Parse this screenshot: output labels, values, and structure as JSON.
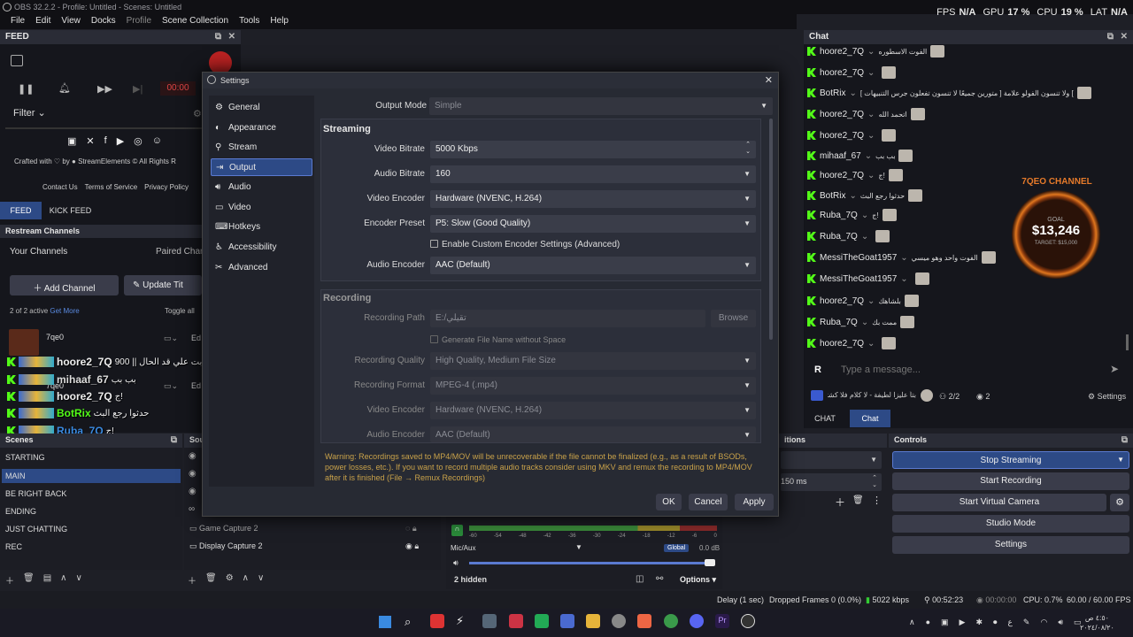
{
  "window": {
    "title": "OBS 32.2.2 - Profile: Untitled - Scenes: Untitled"
  },
  "menu": [
    "File",
    "Edit",
    "View",
    "Docks",
    "Profile",
    "Scene Collection",
    "Tools",
    "Help"
  ],
  "stats": {
    "fps_label": "FPS",
    "fps": "N/A",
    "gpu_label": "GPU",
    "gpu": "17 %",
    "cpu_label": "CPU",
    "cpu": "19 %",
    "lat_label": "LAT",
    "lat": "N/A"
  },
  "feed": {
    "title": "FEED",
    "timer": "00:00",
    "filter": "Filter",
    "crafted": "Crafted with",
    "by": "by",
    "brand": "StreamElements",
    "rights": "© All Rights R",
    "links": [
      "Contact Us",
      "Terms of Service",
      "Privacy Policy"
    ],
    "tabs": [
      "FEED",
      "KICK FEED"
    ]
  },
  "restream": {
    "title": "Restream Channels",
    "your_channels": "Your Channels",
    "paired": "Paired Chan",
    "add_channel": "Add Channel",
    "update_title": "Update Tit",
    "active": "2 of 2 active",
    "get_more": "Get More",
    "toggle_all": "Toggle all",
    "channel1": "7qe0",
    "channel2": "7qe0",
    "edit": "Ed"
  },
  "overlay_chat": [
    {
      "user": "hoore2_7Q",
      "msg": "بت علي قد الحال || 900?"
    },
    {
      "user": "mihaaf_67",
      "msg": "بب بب"
    },
    {
      "user": "hoore2_7Q",
      "msg": "ج!"
    },
    {
      "user": "BotRix",
      "msg": "حدثوا رجع البث"
    },
    {
      "user": "Ruba_7Q",
      "msg": "ج!"
    },
    {
      "user": "BotRix",
      "msg": "حدثوا رجع البث"
    },
    {
      "user": "Ruba_7Q",
      "msg": ""
    },
    {
      "user": "hoore2_7Q",
      "msg": ""
    }
  ],
  "scenes": {
    "title": "Scenes",
    "items": [
      "STARTING",
      "MAIN",
      "BE RIGHT BACK",
      "ENDING",
      "JUST CHATTING",
      "REC"
    ]
  },
  "sources": {
    "title": "Sou",
    "items": [
      "Game Capture 2",
      "Display Capture 2"
    ]
  },
  "mixer": {
    "channel": "Mic/Aux",
    "global": "Global",
    "db": "0.0 dB",
    "hidden": "2 hidden",
    "options": "Options",
    "ticks": [
      "-60",
      "-54",
      "-48",
      "-42",
      "-36",
      "-30",
      "-24",
      "-18",
      "-12",
      "-6",
      "0"
    ],
    "level": 0.0
  },
  "transitions": {
    "title": "itions",
    "duration": "150 ms"
  },
  "controls": {
    "title": "Controls",
    "buttons": [
      "Stop Streaming",
      "Start Recording",
      "Start Virtual Camera",
      "Studio Mode",
      "Settings"
    ]
  },
  "chat": {
    "title": "Chat",
    "rows": [
      {
        "user": "hoore2_7Q",
        "msg": "الفوت الاسطوره"
      },
      {
        "user": "hoore2_7Q",
        "msg": ""
      },
      {
        "user": "BotRix",
        "msg": "[ متورين جميعًا لا تنسون تفعلون جرس التنبيهات ] ولا تنسون الفولو علامة ["
      },
      {
        "user": "hoore2_7Q",
        "msg": "اتحمد الله"
      },
      {
        "user": "hoore2_7Q",
        "msg": ""
      },
      {
        "user": "mihaaf_67",
        "msg": "بب بب"
      },
      {
        "user": "hoore2_7Q",
        "msg": "ج!"
      },
      {
        "user": "BotRix",
        "msg": "حدثوا رجع البث"
      },
      {
        "user": "Ruba_7Q",
        "msg": "ج!"
      },
      {
        "user": "Ruba_7Q",
        "msg": ""
      },
      {
        "user": "MessiTheGoat1957",
        "msg": "الفوت واحد وهو ميسي"
      },
      {
        "user": "MessiTheGoat1957",
        "msg": ""
      },
      {
        "user": "hoore2_7Q",
        "msg": "بلشاهك"
      },
      {
        "user": "Ruba_7Q",
        "msg": "ممت بك"
      },
      {
        "user": "hoore2_7Q",
        "msg": ""
      }
    ],
    "placeholder": "Type a message...",
    "banner_text": "بتاً عليزا لطيفة - لا كلام فلا كشتر",
    "count": "2/2",
    "viewers": "2",
    "settings": "Settings",
    "tabs": [
      "CHAT",
      "Chat"
    ]
  },
  "goal_widget": {
    "channel": "7QEO CHANNEL",
    "amount": "$13,246",
    "goal": "GOAL",
    "target": "TARGET: $15,000"
  },
  "settings_dialog": {
    "title": "Settings",
    "nav": [
      "General",
      "Appearance",
      "Stream",
      "Output",
      "Audio",
      "Video",
      "Hotkeys",
      "Accessibility",
      "Advanced"
    ],
    "output_mode_label": "Output Mode",
    "output_mode": "Simple",
    "streaming_header": "Streaming",
    "video_bitrate_label": "Video Bitrate",
    "video_bitrate": "5000 Kbps",
    "audio_bitrate_label": "Audio Bitrate",
    "audio_bitrate": "160",
    "video_encoder_label": "Video Encoder",
    "video_encoder": "Hardware (NVENC, H.264)",
    "encoder_preset_label": "Encoder Preset",
    "encoder_preset": "P5: Slow (Good Quality)",
    "custom_encoder": "Enable Custom Encoder Settings (Advanced)",
    "audio_encoder_label": "Audio Encoder",
    "audio_encoder": "AAC (Default)",
    "recording_header": "Recording",
    "recording_path_label": "Recording Path",
    "recording_path": "E:/تقيلي",
    "browse": "Browse",
    "gen_filename": "Generate File Name without Space",
    "rec_quality_label": "Recording Quality",
    "rec_quality": "High Quality, Medium File Size",
    "rec_format_label": "Recording Format",
    "rec_format": "MPEG-4 (.mp4)",
    "rec_video_encoder_label": "Video Encoder",
    "rec_video_encoder": "Hardware (NVENC, H.264)",
    "rec_audio_encoder_label": "Audio Encoder",
    "rec_audio_encoder": "AAC (Default)",
    "warning": "Warning: Recordings saved to MP4/MOV will be unrecoverable if the file cannot be finalized (e.g., as a result of BSODs, power losses, etc.). If you want to record multiple audio tracks consider using MKV and remux the recording to MP4/MOV after it is finished (File → Remux Recordings)",
    "ok": "OK",
    "cancel": "Cancel",
    "apply": "Apply"
  },
  "statusbar": {
    "delay": "Delay (1 sec)",
    "dropped": "Dropped Frames 0 (0.0%)",
    "kbps": "5022 kbps",
    "stream_time": "00:52:23",
    "rec_time": "00:00:00",
    "cpu": "CPU: 0.7%",
    "fps": "60.00 / 60.00 FPS"
  },
  "tray": {
    "time": "٤:٥٠ ص",
    "date": "٢٠٢٤/٠٨/٢٠",
    "lang": "ع"
  },
  "colors": {
    "accent": "#2d4a86",
    "kick": "#53fc18",
    "warning": "#c9a24a",
    "bg": "#1e1f26"
  }
}
